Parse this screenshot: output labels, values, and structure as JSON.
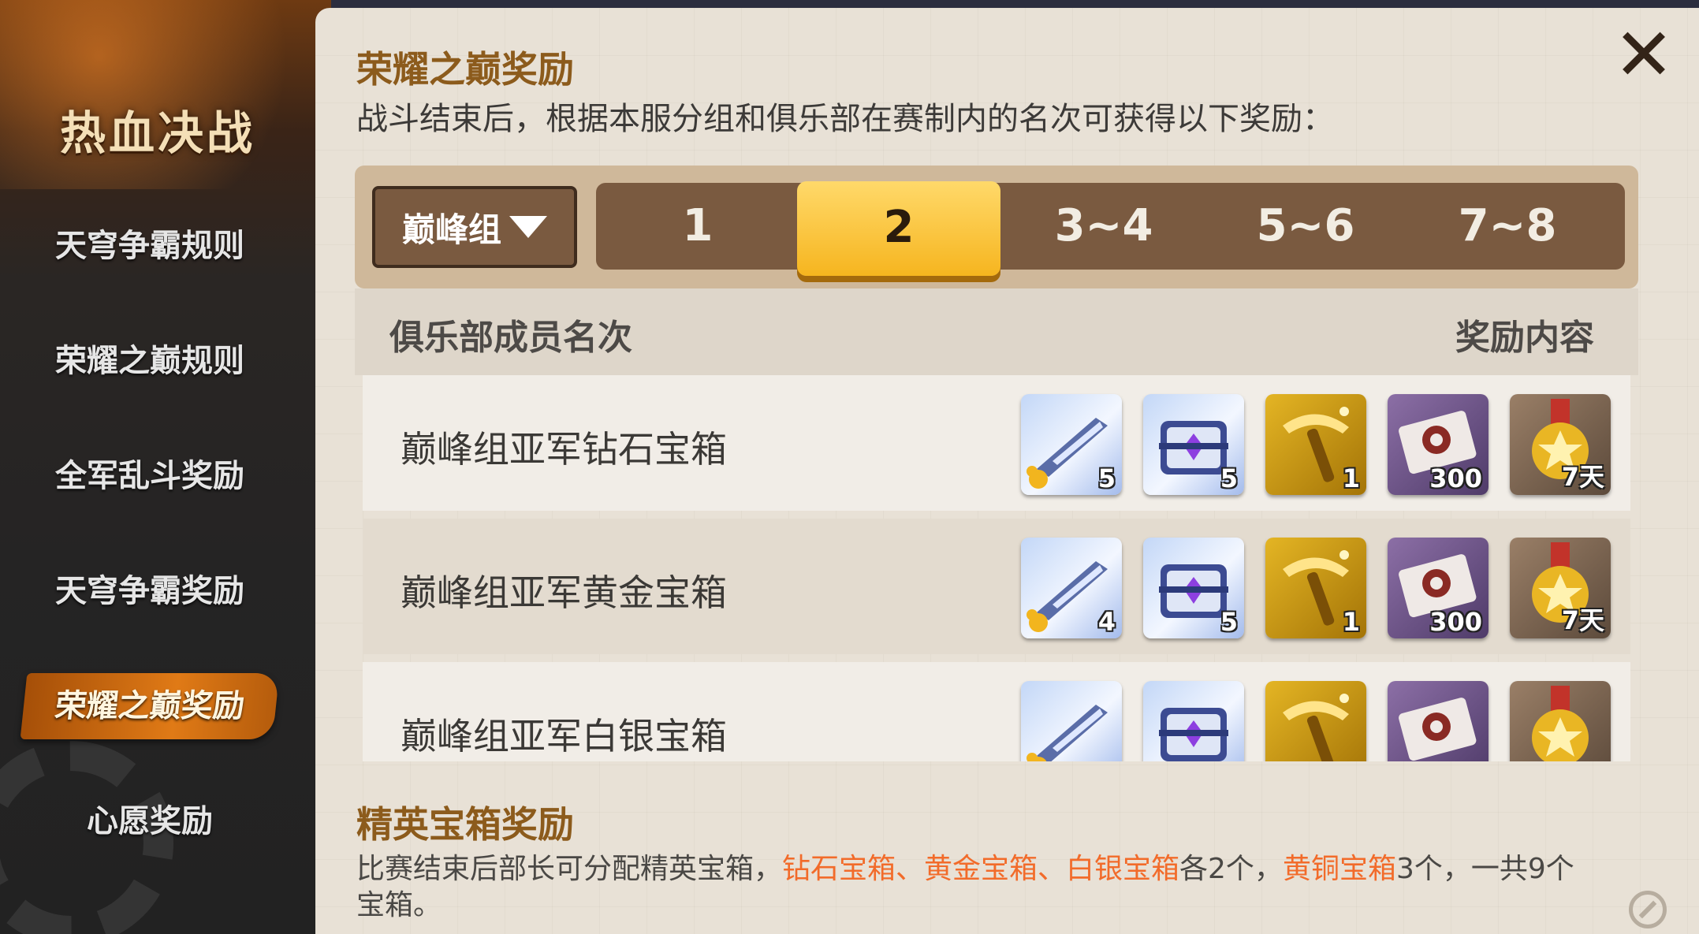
{
  "sidebar": {
    "title": "热血决战",
    "items": [
      {
        "label": "天穹争霸规则",
        "active": false
      },
      {
        "label": "荣耀之巅规则",
        "active": false
      },
      {
        "label": "全军乱斗奖励",
        "active": false
      },
      {
        "label": "天穹争霸奖励",
        "active": false
      },
      {
        "label": "荣耀之巅奖励",
        "active": true
      },
      {
        "label": "心愿奖励",
        "active": false
      }
    ]
  },
  "panel": {
    "section1_title": "荣耀之巅奖励",
    "section1_desc": "战斗结束后，根据本服分组和俱乐部在赛制内的名次可获得以下奖励：",
    "group_select": "巅峰组",
    "rank_tabs": [
      "1",
      "2",
      "3~4",
      "5~6",
      "7~8"
    ],
    "active_tab_index": 1,
    "table": {
      "col_left": "俱乐部成员名次",
      "col_right": "奖励内容",
      "rows": [
        {
          "name": "巅峰组亚军钻石宝箱",
          "rewards": [
            {
              "icon": "weapon-fragment-icon",
              "qty": "5"
            },
            {
              "icon": "treasure-chest-icon",
              "qty": "5"
            },
            {
              "icon": "golden-hammer-icon",
              "qty": "1"
            },
            {
              "icon": "ticket-icon",
              "qty": "300"
            },
            {
              "icon": "medal-badge-icon",
              "qty": "7天"
            }
          ]
        },
        {
          "name": "巅峰组亚军黄金宝箱",
          "rewards": [
            {
              "icon": "weapon-fragment-icon",
              "qty": "4"
            },
            {
              "icon": "treasure-chest-icon",
              "qty": "5"
            },
            {
              "icon": "golden-hammer-icon",
              "qty": "1"
            },
            {
              "icon": "ticket-icon",
              "qty": "300"
            },
            {
              "icon": "medal-badge-icon",
              "qty": "7天"
            }
          ]
        },
        {
          "name": "巅峰组亚军白银宝箱",
          "rewards": [
            {
              "icon": "weapon-fragment-icon",
              "qty": ""
            },
            {
              "icon": "treasure-chest-icon",
              "qty": ""
            },
            {
              "icon": "golden-hammer-icon",
              "qty": ""
            },
            {
              "icon": "ticket-icon",
              "qty": ""
            },
            {
              "icon": "medal-badge-icon",
              "qty": ""
            }
          ]
        }
      ]
    },
    "section2_title": "精英宝箱奖励",
    "section2_desc": {
      "p1": "比赛结束后部长可分配精英宝箱，",
      "h1": "钻石宝箱、黄金宝箱、白银宝箱",
      "p2": "各2个，",
      "h2": "黄铜宝箱",
      "p3": "3个，一共9个宝箱。"
    }
  },
  "colors": {
    "accent_orange": "#e07a16",
    "active_tab_gold": "#f6b51f",
    "highlight_text": "#f26b2a",
    "heading_brown": "#8c5b1c"
  }
}
